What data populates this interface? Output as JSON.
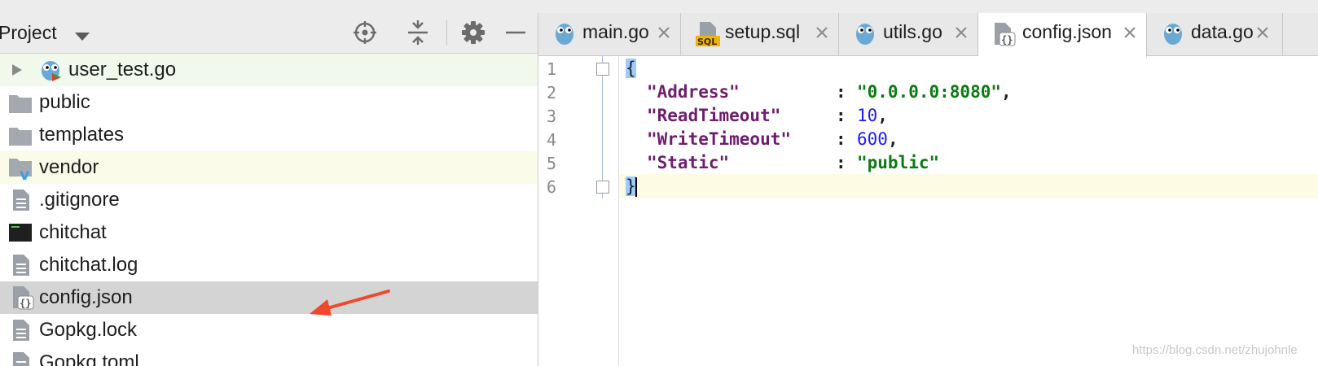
{
  "project_panel": {
    "title": "Project",
    "toolbar_icons": [
      "locate-icon",
      "collapse-all-icon",
      "gear-icon",
      "minimize-icon"
    ],
    "tree": [
      {
        "label": "user_test.go",
        "icon": "go-test-file-icon",
        "expandable": true,
        "highlight": "green"
      },
      {
        "label": "public",
        "icon": "folder-icon",
        "highlight": "none"
      },
      {
        "label": "templates",
        "icon": "folder-icon",
        "highlight": "none"
      },
      {
        "label": "vendor",
        "icon": "vendor-folder-icon",
        "highlight": "yellow"
      },
      {
        "label": ".gitignore",
        "icon": "text-file-icon",
        "highlight": "none"
      },
      {
        "label": "chitchat",
        "icon": "executable-icon",
        "highlight": "none"
      },
      {
        "label": "chitchat.log",
        "icon": "text-file-icon",
        "highlight": "none"
      },
      {
        "label": "config.json",
        "icon": "json-file-icon",
        "highlight": "selected"
      },
      {
        "label": "Gopkg.lock",
        "icon": "text-file-icon",
        "highlight": "none"
      },
      {
        "label": "Gopkg.toml",
        "icon": "text-file-icon",
        "highlight": "none"
      }
    ]
  },
  "editor": {
    "tabs": [
      {
        "label": "main.go",
        "icon": "go-gopher-icon",
        "active": false
      },
      {
        "label": "setup.sql",
        "icon": "sql-file-icon",
        "active": false
      },
      {
        "label": "utils.go",
        "icon": "go-gopher-icon",
        "active": false
      },
      {
        "label": "config.json",
        "icon": "json-file-icon",
        "active": true
      },
      {
        "label": "data.go",
        "icon": "go-gopher-icon",
        "active": false
      }
    ],
    "line_numbers": [
      "1",
      "2",
      "3",
      "4",
      "5",
      "6"
    ],
    "code": {
      "open_brace": "{",
      "close_brace": "}",
      "colon": ":",
      "comma": ",",
      "lines": [
        {
          "key": "\"Address\"",
          "value": "\"0.0.0.0:8080\"",
          "type": "string",
          "comma": true
        },
        {
          "key": "\"ReadTimeout\"",
          "value": "10",
          "type": "number",
          "comma": true
        },
        {
          "key": "\"WriteTimeout\"",
          "value": "600",
          "type": "number",
          "comma": true
        },
        {
          "key": "\"Static\"",
          "value": "\"public\"",
          "type": "string",
          "comma": false
        }
      ]
    }
  },
  "watermark": "https://blog.csdn.net/zhujohnle",
  "colors": {
    "json_key": "#6e1d6f",
    "json_string": "#0c7a12",
    "json_number": "#1a1aff",
    "brace_match": "#9ecbff",
    "annotation_arrow": "#f0492a"
  }
}
